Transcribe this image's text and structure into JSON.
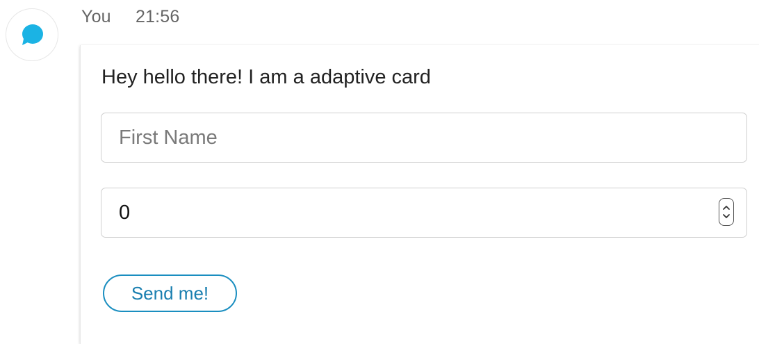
{
  "message": {
    "sender": "You",
    "time": "21:56",
    "avatar_icon": "chat-bubble-icon",
    "avatar_color": "#1bb3e4"
  },
  "card": {
    "text": "Hey hello there! I am a adaptive card",
    "first_name": {
      "placeholder": "First Name",
      "value": ""
    },
    "number": {
      "value": "0",
      "stepper_icon": "up-down-chevron-icon"
    },
    "submit_label": "Send me!",
    "accent_color": "#1a8ec0"
  }
}
